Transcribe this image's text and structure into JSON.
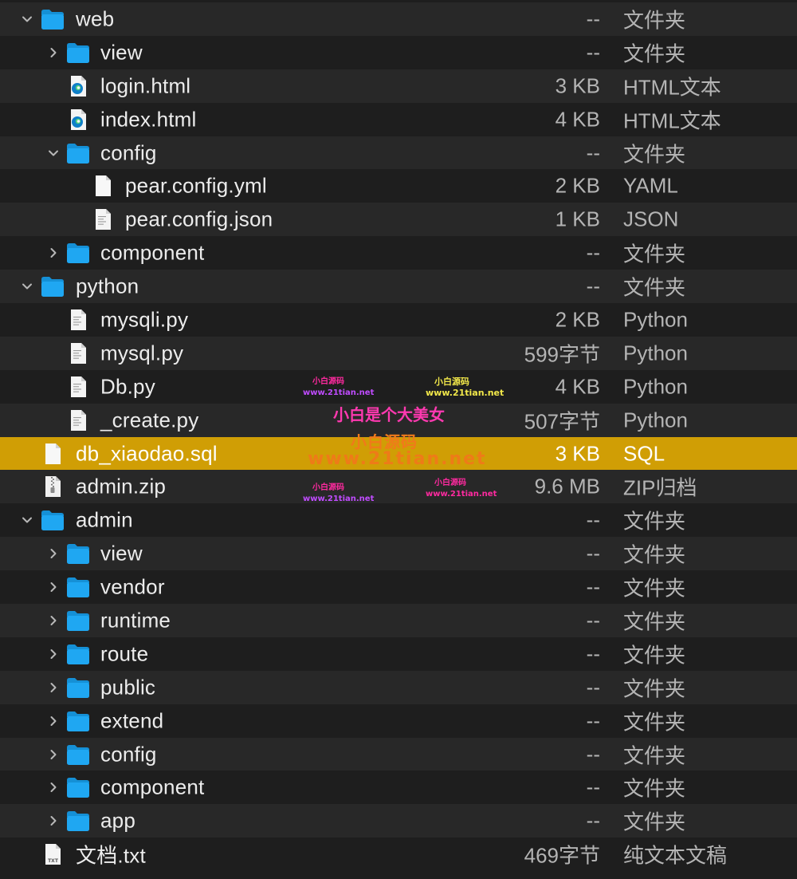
{
  "colors": {
    "background": "#1e1e1e",
    "row_alt": "#282828",
    "selection": "#d09e05",
    "folder_blue": "#1fa7f2",
    "text": "#ececec",
    "secondary_text": "#b4b4b4"
  },
  "rows": [
    {
      "name": "web",
      "size": "--",
      "kind": "文件夹",
      "icon": "folder-icon",
      "expanded": true,
      "level": 0,
      "disclosure": "down"
    },
    {
      "name": "view",
      "size": "--",
      "kind": "文件夹",
      "icon": "folder-icon",
      "expanded": false,
      "level": 1,
      "disclosure": "right"
    },
    {
      "name": "login.html",
      "size": "3 KB",
      "kind": "HTML文本",
      "icon": "edge-html-icon",
      "level": 1,
      "disclosure": "none"
    },
    {
      "name": "index.html",
      "size": "4 KB",
      "kind": "HTML文本",
      "icon": "edge-html-icon",
      "level": 1,
      "disclosure": "none"
    },
    {
      "name": "config",
      "size": "--",
      "kind": "文件夹",
      "icon": "folder-icon",
      "expanded": true,
      "level": 1,
      "disclosure": "down"
    },
    {
      "name": "pear.config.yml",
      "size": "2 KB",
      "kind": "YAML",
      "icon": "blank-document-icon",
      "level": 2,
      "disclosure": "none"
    },
    {
      "name": "pear.config.json",
      "size": "1 KB",
      "kind": "JSON",
      "icon": "text-document-icon",
      "level": 2,
      "disclosure": "none"
    },
    {
      "name": "component",
      "size": "--",
      "kind": "文件夹",
      "icon": "folder-icon",
      "expanded": false,
      "level": 1,
      "disclosure": "right"
    },
    {
      "name": "python",
      "size": "--",
      "kind": "文件夹",
      "icon": "folder-icon",
      "expanded": true,
      "level": 0,
      "disclosure": "down"
    },
    {
      "name": "mysqli.py",
      "size": "2 KB",
      "kind": "Python",
      "icon": "python-document-icon",
      "level": 1,
      "disclosure": "none"
    },
    {
      "name": "mysql.py",
      "size": "599字节",
      "kind": "Python",
      "icon": "python-document-icon",
      "level": 1,
      "disclosure": "none"
    },
    {
      "name": "Db.py",
      "size": "4 KB",
      "kind": "Python",
      "icon": "python-document-icon",
      "level": 1,
      "disclosure": "none"
    },
    {
      "name": "_create.py",
      "size": "507字节",
      "kind": "Python",
      "icon": "python-document-icon",
      "level": 1,
      "disclosure": "none"
    },
    {
      "name": "db_xiaodao.sql",
      "size": "3 KB",
      "kind": "SQL",
      "icon": "blank-document-icon",
      "level": 0,
      "disclosure": "none",
      "selected": true
    },
    {
      "name": "admin.zip",
      "size": "9.6 MB",
      "kind": "ZIP归档",
      "icon": "zip-archive-icon",
      "level": 0,
      "disclosure": "none"
    },
    {
      "name": "admin",
      "size": "--",
      "kind": "文件夹",
      "icon": "folder-icon",
      "expanded": true,
      "level": 0,
      "disclosure": "down"
    },
    {
      "name": "view",
      "size": "--",
      "kind": "文件夹",
      "icon": "folder-icon",
      "expanded": false,
      "level": 1,
      "disclosure": "right"
    },
    {
      "name": "vendor",
      "size": "--",
      "kind": "文件夹",
      "icon": "folder-icon",
      "expanded": false,
      "level": 1,
      "disclosure": "right"
    },
    {
      "name": "runtime",
      "size": "--",
      "kind": "文件夹",
      "icon": "folder-icon",
      "expanded": false,
      "level": 1,
      "disclosure": "right"
    },
    {
      "name": "route",
      "size": "--",
      "kind": "文件夹",
      "icon": "folder-icon",
      "expanded": false,
      "level": 1,
      "disclosure": "right"
    },
    {
      "name": "public",
      "size": "--",
      "kind": "文件夹",
      "icon": "folder-icon",
      "expanded": false,
      "level": 1,
      "disclosure": "right"
    },
    {
      "name": "extend",
      "size": "--",
      "kind": "文件夹",
      "icon": "folder-icon",
      "expanded": false,
      "level": 1,
      "disclosure": "right"
    },
    {
      "name": "config",
      "size": "--",
      "kind": "文件夹",
      "icon": "folder-icon",
      "expanded": false,
      "level": 1,
      "disclosure": "right"
    },
    {
      "name": "component",
      "size": "--",
      "kind": "文件夹",
      "icon": "folder-icon",
      "expanded": false,
      "level": 1,
      "disclosure": "right"
    },
    {
      "name": "app",
      "size": "--",
      "kind": "文件夹",
      "icon": "folder-icon",
      "expanded": false,
      "level": 1,
      "disclosure": "right"
    },
    {
      "name": "文档.txt",
      "size": "469字节",
      "kind": "纯文本文稿",
      "icon": "txt-document-icon",
      "level": 0,
      "disclosure": "none"
    }
  ],
  "watermarks": {
    "brand_a": "小白源码",
    "brand_b": "小白源码",
    "url_a": "www.21tian.net",
    "url_b": "www.21tian.net",
    "slogan": "小白是个大美女",
    "brand_big": "小白源码",
    "url_big": "www.21tian.net",
    "brand_c": "小白源码",
    "brand_d": "小白源码",
    "url_c": "www.21tian.net",
    "url_d": "www.21tian.net"
  }
}
